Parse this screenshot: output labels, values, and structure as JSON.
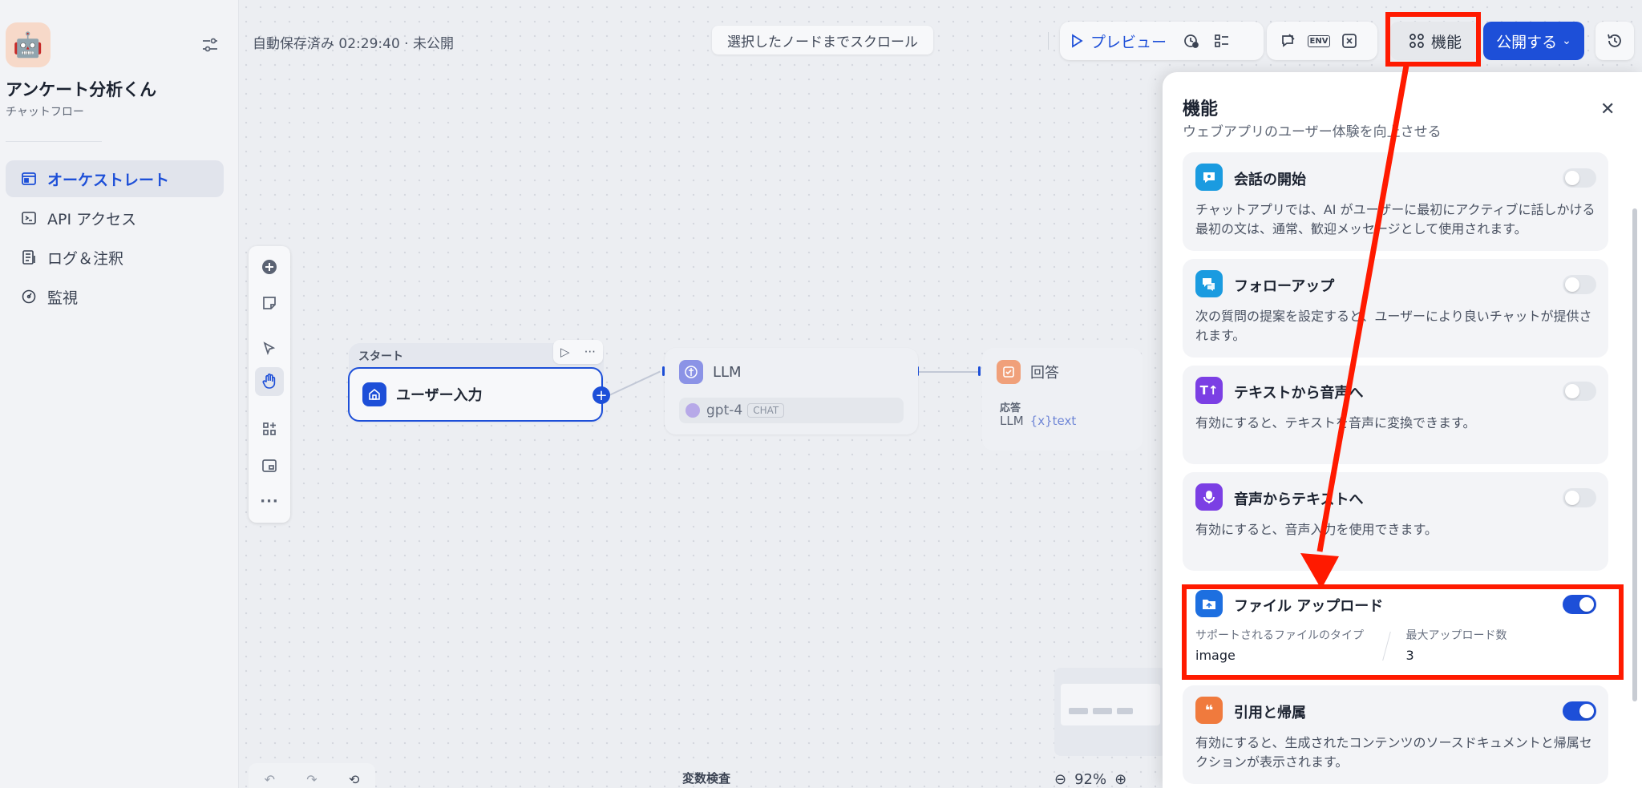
{
  "app": {
    "name": "アンケート分析くん",
    "type": "チャットフロー",
    "icon": "robot-icon"
  },
  "sidebar": {
    "items": [
      {
        "label": "オーケストレート",
        "icon": "orchestrate-icon",
        "active": true
      },
      {
        "label": "API アクセス",
        "icon": "terminal-icon",
        "active": false
      },
      {
        "label": "ログ＆注釈",
        "icon": "log-icon",
        "active": false
      },
      {
        "label": "監視",
        "icon": "monitor-icon",
        "active": false
      }
    ]
  },
  "topbar": {
    "status": "自動保存済み 02:29:40 · 未公開",
    "scroll_to_node": "選択したノードまでスクロール",
    "preview": "プレビュー",
    "features": "機能",
    "publish": "公開する",
    "env_label": "ENV"
  },
  "nodes": {
    "start_label": "スタート",
    "start_title": "ユーザー入力",
    "llm_title": "LLM",
    "llm_model": "gpt-4",
    "llm_mode": "CHAT",
    "answer_title": "回答",
    "answer_label": "応答",
    "answer_ref_node": "LLM",
    "answer_ref_var": "{x}text"
  },
  "bottom": {
    "variable_inspect": "変数検査",
    "zoom": "92%"
  },
  "panel": {
    "title": "機能",
    "subtitle": "ウェブアプリのユーザー体験を向上させる",
    "features": [
      {
        "title": "会話の開始",
        "desc": "チャットアプリでは、AI がユーザーに最初にアクティブに話しかける最初の文は、通常、歓迎メッセージとして使用されます。",
        "enabled": false,
        "icon": "chat-bubble-icon",
        "color": "#1a9be0"
      },
      {
        "title": "フォローアップ",
        "desc": "次の質問の提案を設定すると、ユーザーにより良いチャットが提供されます。",
        "enabled": false,
        "icon": "follow-up-icon",
        "color": "#1a9be0"
      },
      {
        "title": "テキストから音声へ",
        "desc": "有効にすると、テキストを音声に変換できます。",
        "enabled": false,
        "icon": "text-to-speech-icon",
        "color": "#7b3fe4"
      },
      {
        "title": "音声からテキストへ",
        "desc": "有効にすると、音声入力を使用できます。",
        "enabled": false,
        "icon": "microphone-icon",
        "color": "#7b3fe4"
      },
      {
        "title": "ファイル アップロード",
        "enabled": true,
        "icon": "folder-upload-icon",
        "color": "#1d6fe0",
        "file_types_label": "サポートされるファイルのタイプ",
        "file_types": "image",
        "max_uploads_label": "最大アップロード数",
        "max_uploads": "3"
      },
      {
        "title": "引用と帰属",
        "desc": "有効にすると、生成されたコンテンツのソースドキュメントと帰属セクションが表示されます。",
        "enabled": true,
        "icon": "quote-icon",
        "color": "#f07a3d"
      }
    ]
  },
  "annotation_color": "#ff1a00"
}
